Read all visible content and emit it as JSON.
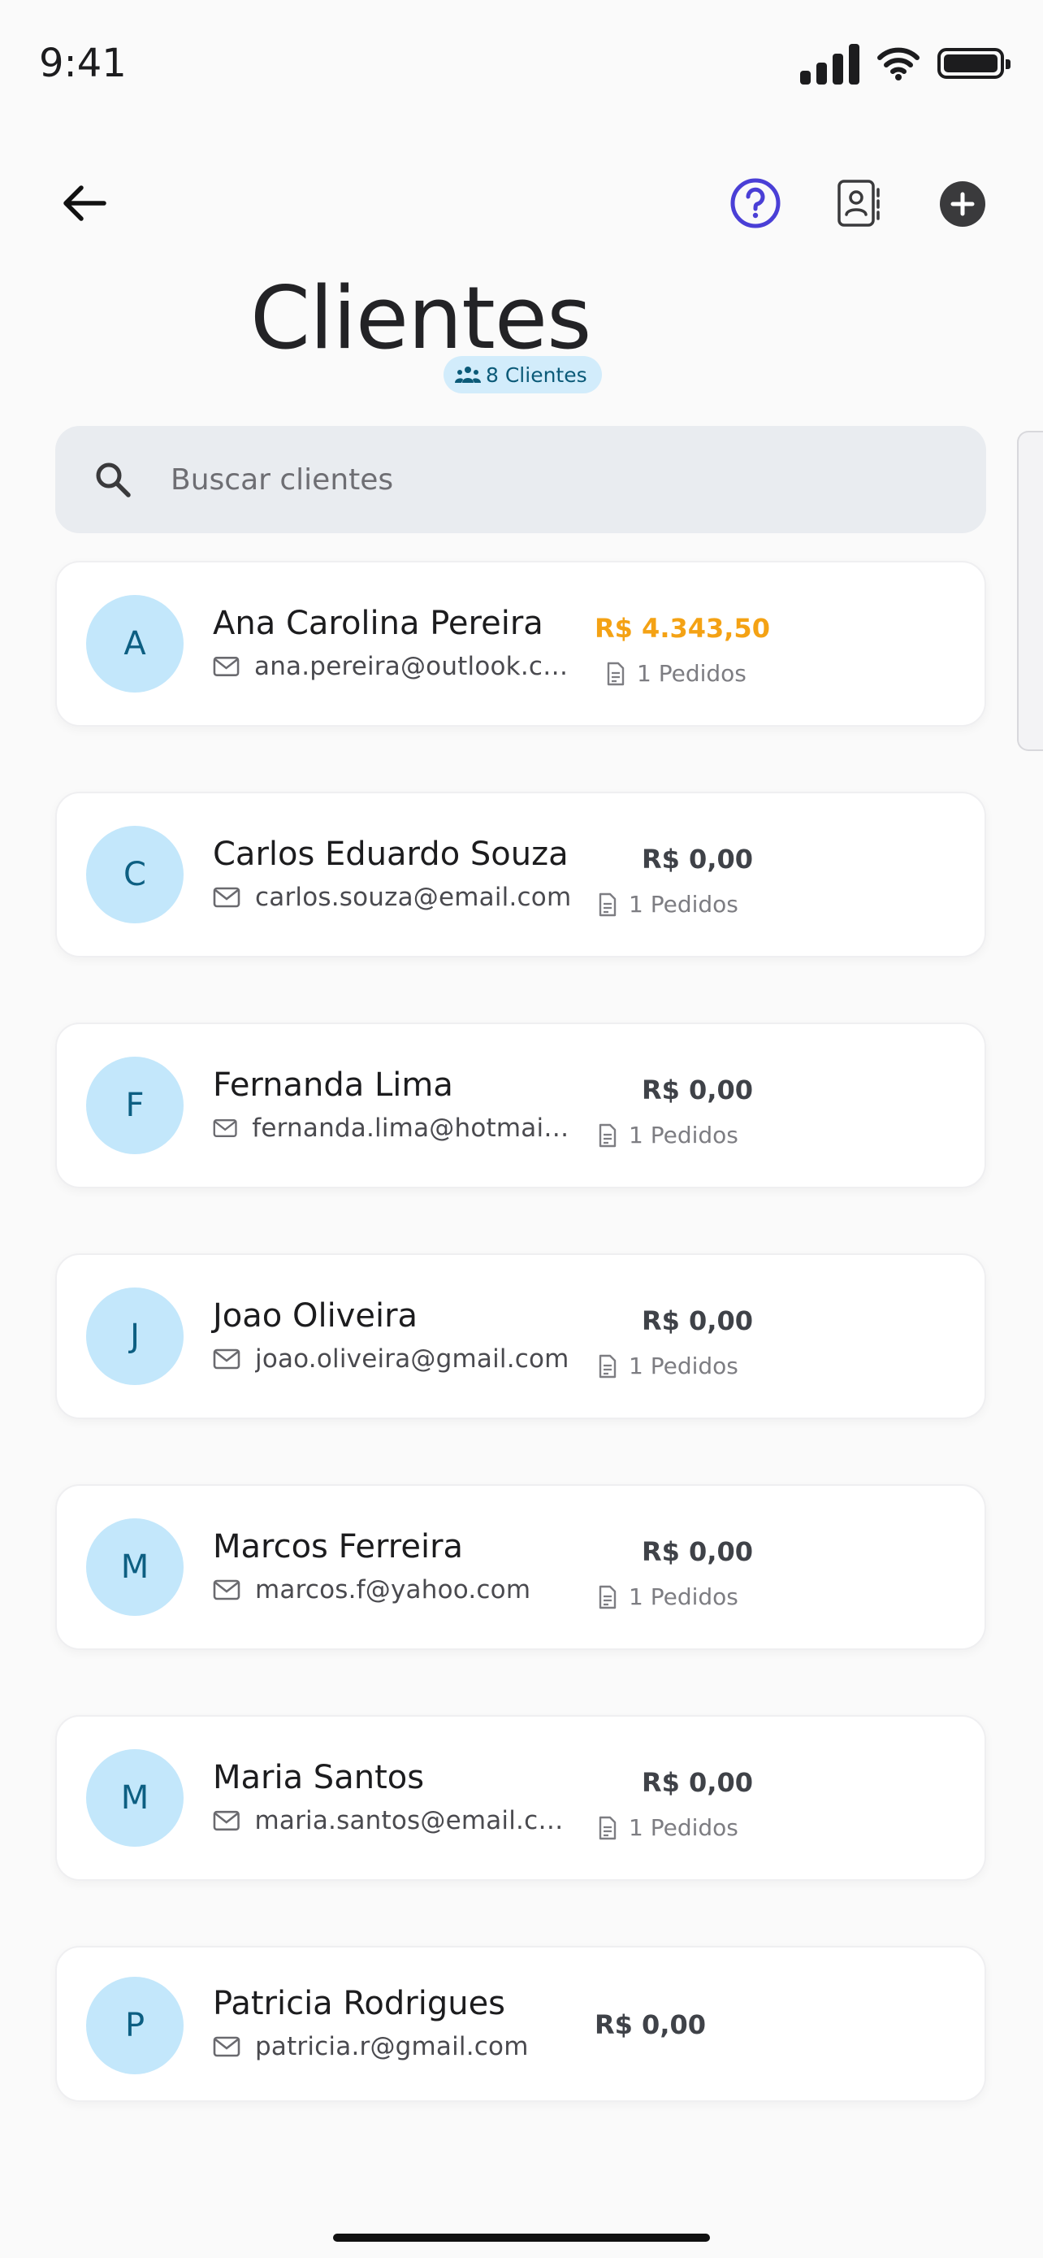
{
  "status_bar": {
    "time": "9:41"
  },
  "header": {
    "title": "Clientes",
    "count_badge": "8 Clientes"
  },
  "search": {
    "placeholder": "Buscar clientes"
  },
  "clients": [
    {
      "initial": "A",
      "name": "Ana Carolina Pereira",
      "email": "ana.pereira@outlook.com",
      "amount": "R$ 4.343,50",
      "orders": "1 Pedidos"
    },
    {
      "initial": "C",
      "name": "Carlos Eduardo Souza",
      "email": "carlos.souza@email.com",
      "amount": "R$ 0,00",
      "orders": "1 Pedidos"
    },
    {
      "initial": "F",
      "name": "Fernanda Lima",
      "email": "fernanda.lima@hotmail.com",
      "amount": "R$ 0,00",
      "orders": "1 Pedidos"
    },
    {
      "initial": "J",
      "name": "Joao Oliveira",
      "email": "joao.oliveira@gmail.com",
      "amount": "R$ 0,00",
      "orders": "1 Pedidos"
    },
    {
      "initial": "M",
      "name": "Marcos Ferreira",
      "email": "marcos.f@yahoo.com",
      "amount": "R$ 0,00",
      "orders": "1 Pedidos"
    },
    {
      "initial": "M",
      "name": "Maria Santos",
      "email": "maria.santos@email.com",
      "amount": "R$ 0,00",
      "orders": "1 Pedidos"
    },
    {
      "initial": "P",
      "name": "Patricia Rodrigues",
      "email": "patricia.r@gmail.com",
      "amount": "R$ 0,00"
    }
  ],
  "colors": {
    "help_accent": "#4a3fd6",
    "amount_highlight": "#f4a214",
    "avatar_bg": "#c3e7fb",
    "badge_bg": "#d2ecfb"
  },
  "icons": {
    "back": "arrow-left-icon",
    "help": "help-circle-icon",
    "contacts": "contact-book-icon",
    "add": "plus-circle-icon",
    "search": "search-icon",
    "email": "mail-icon",
    "orders": "document-icon",
    "badge": "users-icon"
  }
}
